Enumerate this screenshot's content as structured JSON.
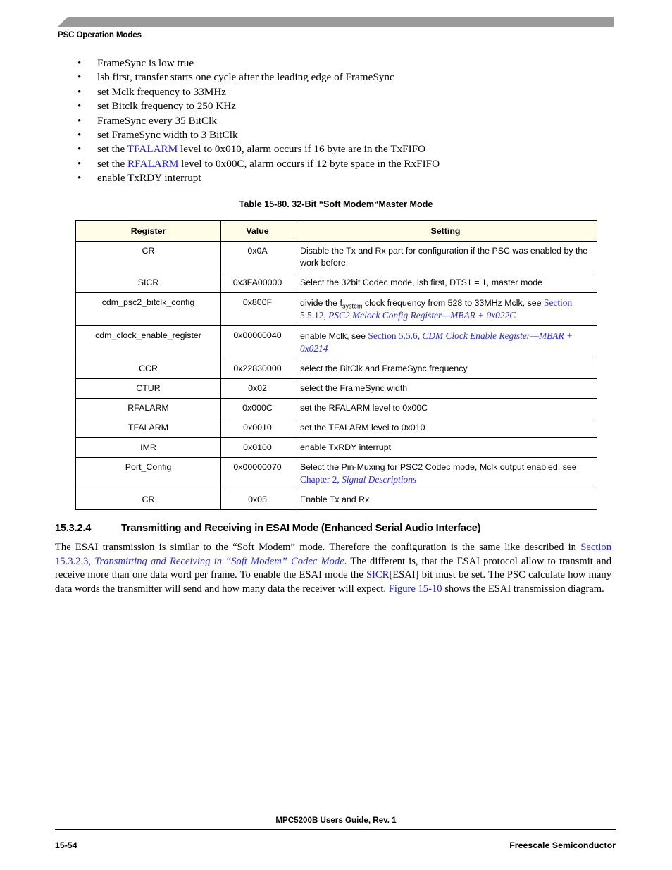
{
  "page": {
    "running_header": "PSC Operation Modes",
    "accent_gray": "#9a9a9a",
    "link_blue": "#2a2ae0",
    "table_header_bg": "#fffde8"
  },
  "bullets": [
    {
      "mark": "•",
      "pre": "",
      "link": "",
      "post": "FrameSync is low true"
    },
    {
      "mark": "•",
      "pre": "",
      "link": "",
      "post": "lsb first, transfer starts one cycle after the leading edge of FrameSync"
    },
    {
      "mark": "•",
      "pre": "",
      "link": "",
      "post": "set Mclk frequency to 33MHz"
    },
    {
      "mark": "•",
      "pre": "",
      "link": "",
      "post": "set Bitclk frequency to 250 KHz"
    },
    {
      "mark": "•",
      "pre": "",
      "link": "",
      "post": "FrameSync every 35 BitClk"
    },
    {
      "mark": "•",
      "pre": "",
      "link": "",
      "post": "set FrameSync width to 3 BitClk"
    },
    {
      "mark": "•",
      "pre": "set the ",
      "link": "TFALARM",
      "post": " level to 0x010, alarm occurs if 16 byte are in the TxFIFO"
    },
    {
      "mark": "•",
      "pre": "set the ",
      "link": "RFALARM",
      "post": " level to 0x00C, alarm occurs if 12 byte space in the RxFIFO"
    },
    {
      "mark": "•",
      "pre": "",
      "link": "",
      "post": "enable TxRDY interrupt"
    }
  ],
  "table": {
    "caption": "Table 15-80. 32-Bit “Soft Modem“Master Mode",
    "columns": [
      "Register",
      "Value",
      "Setting"
    ],
    "rows": [
      {
        "register": "CR",
        "value": "0x0A",
        "setting_text": "Disable the Tx and Rx part for configuration if the PSC was enabled by the work before.",
        "xref_lead": "",
        "xref_section": "",
        "xref_title": ""
      },
      {
        "register": "SICR",
        "value": "0x3FA00000",
        "setting_text": "Select the 32bit Codec mode, lsb first, DTS1 = 1, master mode",
        "xref_lead": "",
        "xref_section": "",
        "xref_title": ""
      },
      {
        "register": "cdm_psc2_bitclk_config",
        "value": "0x800F",
        "setting_prefix": "divide the f",
        "setting_subscript": "system",
        "setting_text": " clock frequency from 528 to 33MHz Mclk, see ",
        "xref_section": "Section 5.5.12, ",
        "xref_title": "PSC2 Mclock Config Register—MBAR + 0x022C"
      },
      {
        "register": "cdm_clock_enable_register",
        "value": "0x00000040",
        "setting_text": "enable Mclk, see ",
        "xref_section": "Section 5.5.6, ",
        "xref_title": "CDM Clock Enable Register—MBAR + 0x0214"
      },
      {
        "register": "CCR",
        "value": "0x22830000",
        "setting_text": "select the BitClk and FrameSync frequency",
        "xref_section": "",
        "xref_title": ""
      },
      {
        "register": "CTUR",
        "value": "0x02",
        "setting_text": "select the FrameSync width",
        "xref_section": "",
        "xref_title": ""
      },
      {
        "register": "RFALARM",
        "value": "0x000C",
        "setting_text": "set the RFALARM level to 0x00C",
        "xref_section": "",
        "xref_title": ""
      },
      {
        "register": "TFALARM",
        "value": "0x0010",
        "setting_text": "set the TFALARM level to 0x010",
        "xref_section": "",
        "xref_title": ""
      },
      {
        "register": "IMR",
        "value": "0x0100",
        "setting_text": "enable TxRDY interrupt",
        "xref_section": "",
        "xref_title": ""
      },
      {
        "register": "Port_Config",
        "value": "0x00000070",
        "setting_text": "Select the Pin-Muxing for PSC2 Codec mode, Mclk output enabled, see ",
        "xref_section": "Chapter 2, ",
        "xref_title": "Signal Descriptions"
      },
      {
        "register": "CR",
        "value": "0x05",
        "setting_text": "Enable Tx and Rx",
        "xref_section": "",
        "xref_title": ""
      }
    ]
  },
  "section": {
    "number": "15.3.2.4",
    "title": "Transmitting and Receiving in ESAI Mode (Enhanced Serial Audio Interface)",
    "paragraph": {
      "p1": "The ESAI transmission is similar to the “Soft Modem” mode. Therefore the configuration is the same like described in ",
      "link1_section": "Section 15.3.2.3, ",
      "link1_title": "Transmitting and Receiving in “Soft Modem” Codec Mode",
      "p2": ". The different is, that the ESAI protocol allow to transmit and receive more than one data word per frame. To enable the ESAI mode the ",
      "link2": "SICR",
      "p3": "[ESAI] bit must be set. The PSC calculate how many data words the transmitter will send and how many data the receiver will expect. ",
      "link3": "Figure 15-10",
      "p4": " shows the ESAI transmission diagram."
    }
  },
  "footer": {
    "title": "MPC5200B Users Guide, Rev. 1",
    "page_number": "15-54",
    "company": "Freescale Semiconductor"
  }
}
